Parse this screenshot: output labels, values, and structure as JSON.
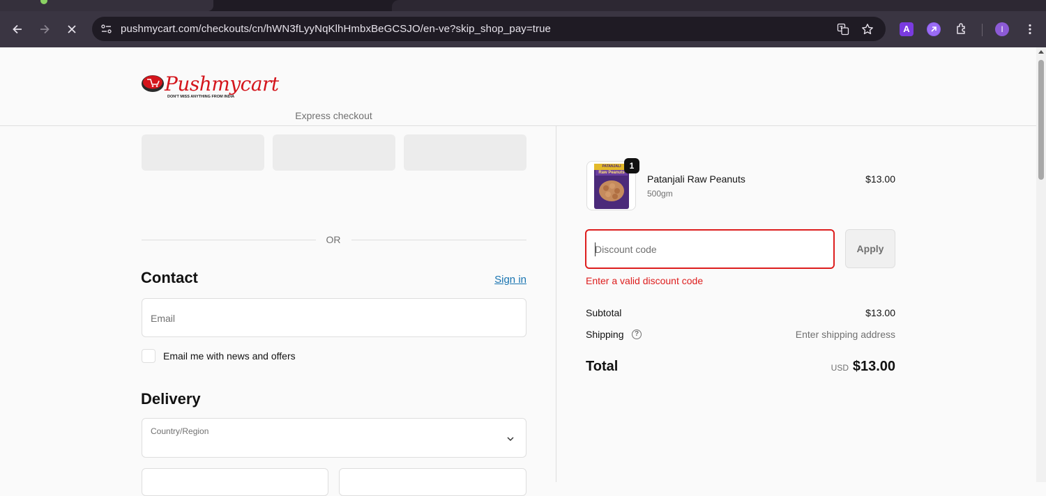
{
  "browser": {
    "url": "pushmycart.com/checkouts/cn/hWN3fLyyNqKlhHmbxBeGCSJO/en-ve?skip_shop_pay=true",
    "profile_initial": "I",
    "extension_a_label": "A"
  },
  "header": {
    "logo_text": "Pushmycart",
    "logo_tagline": "DON'T MISS ANYTHING FROM INDIA"
  },
  "checkout": {
    "express_title": "Express checkout",
    "or_label": "OR",
    "contact_heading": "Contact",
    "sign_in_label": "Sign in",
    "email_placeholder": "Email",
    "news_checkbox_label": "Email me with news and offers",
    "delivery_heading": "Delivery",
    "country_label": "Country/Region"
  },
  "summary": {
    "item": {
      "name": "Patanjali Raw Peanuts",
      "variant": "500gm",
      "price": "$13.00",
      "quantity": "1",
      "thumb_brand": "PATANJALI",
      "thumb_title": "Raw Peanuts"
    },
    "discount_placeholder": "Discount code",
    "apply_label": "Apply",
    "discount_error": "Enter a valid discount code",
    "subtotal_label": "Subtotal",
    "subtotal_value": "$13.00",
    "shipping_label": "Shipping",
    "shipping_value": "Enter shipping address",
    "total_label": "Total",
    "currency": "USD",
    "total_value": "$13.00"
  },
  "colors": {
    "error": "#dd1d1d",
    "link": "#1773b0",
    "brand_red": "#d4151c"
  }
}
